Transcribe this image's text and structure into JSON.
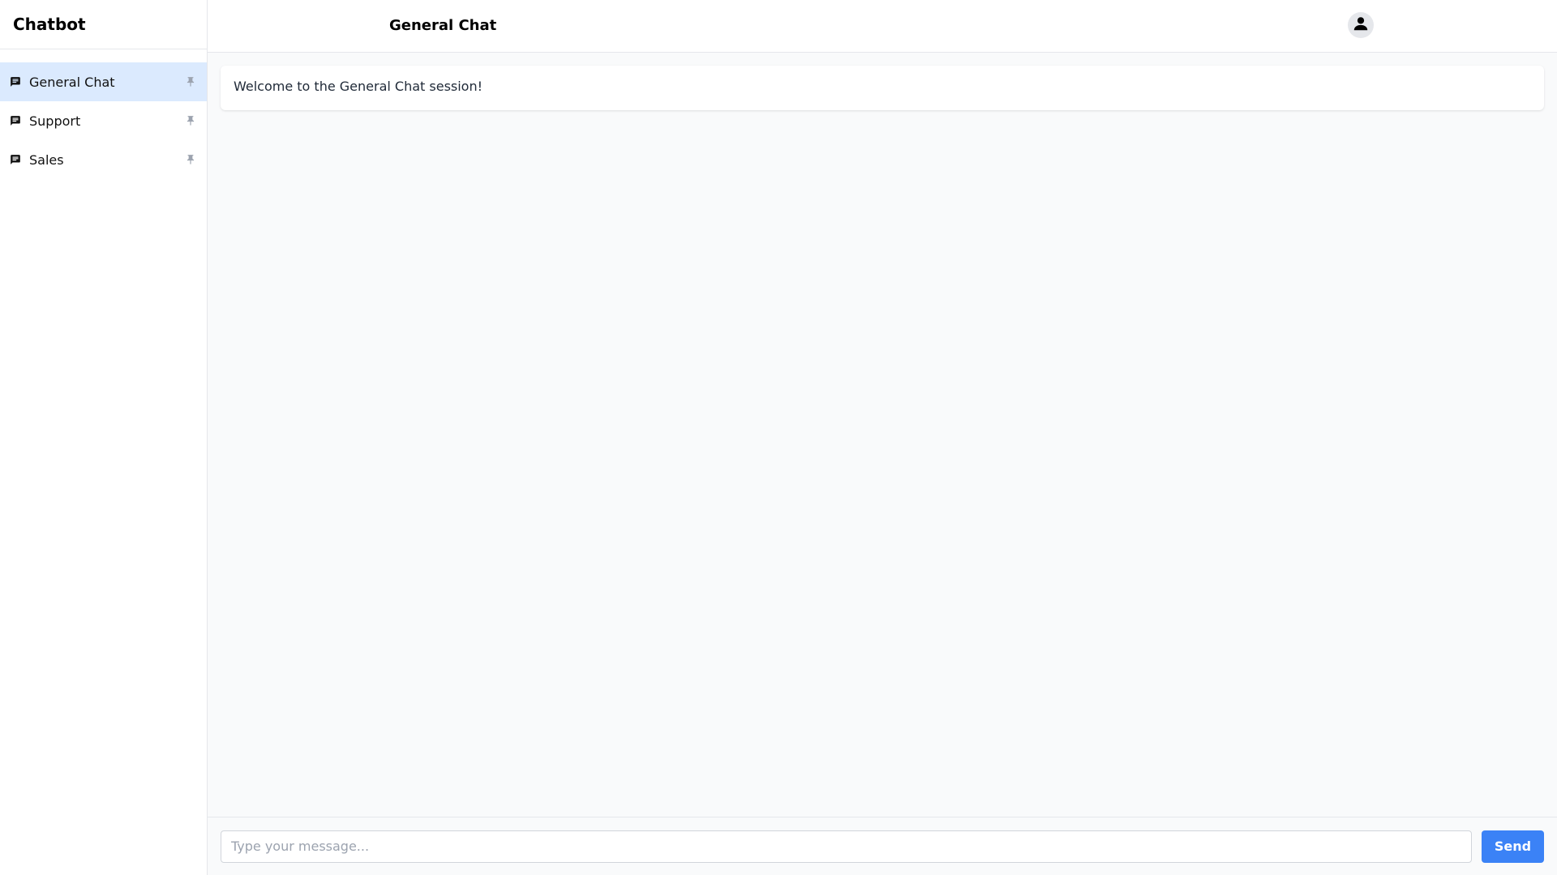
{
  "app": {
    "title": "Chatbot"
  },
  "sidebar": {
    "sessions": [
      {
        "label": "General Chat",
        "active": true
      },
      {
        "label": "Support",
        "active": false
      },
      {
        "label": "Sales",
        "active": false
      }
    ]
  },
  "header": {
    "title": "General Chat"
  },
  "messages": [
    {
      "text": "Welcome to the General Chat session!"
    }
  ],
  "composer": {
    "placeholder": "Type your message...",
    "send_label": "Send"
  },
  "colors": {
    "accent": "#3b82f6",
    "active_session_bg": "#dbeafe",
    "pin": "#9ca3af"
  },
  "icons": {
    "session": "chat-bubble-icon",
    "pin": "pin-icon",
    "avatar": "user-icon"
  }
}
